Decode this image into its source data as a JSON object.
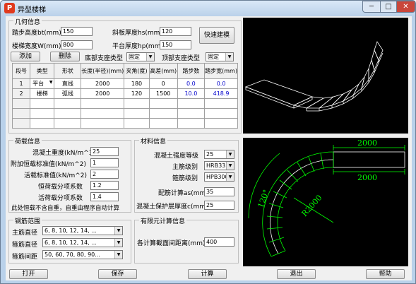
{
  "window": {
    "title": "异型楼梯",
    "app_icon": "P",
    "min_glyph": "─",
    "max_glyph": "□",
    "close_glyph": "✕"
  },
  "geometry": {
    "title": "几何信息",
    "step_height_label": "踏步高度bt(mm)",
    "step_height": "150",
    "slab_thickness_label": "斜板厚度hs(mm)",
    "slab_thickness": "120",
    "stair_width_label": "楼梯宽度W(mm)",
    "stair_width": "800",
    "platform_thickness_label": "平台厚度hp(mm)",
    "platform_thickness": "150",
    "quick_build_label": "快速建模",
    "add_label": "添加",
    "delete_label": "删除",
    "bottom_support_label": "底部支座类型",
    "bottom_support_value": "固定",
    "top_support_label": "顶部支座类型",
    "top_support_value": "固定",
    "table": {
      "headers": [
        "段号",
        "类型",
        "形状",
        "长度(半径)(mm)",
        "夹角(度)",
        "高差(mm)",
        "踏步数",
        "踏步宽(mm)"
      ],
      "rows": [
        [
          "1",
          "平台",
          "直线",
          "2000",
          "180",
          "0",
          "0.0",
          "0.0"
        ],
        [
          "2",
          "楼梯",
          "弧线",
          "2000",
          "120",
          "1500",
          "10.0",
          "418.9"
        ]
      ]
    }
  },
  "load": {
    "title": "荷载信息",
    "concrete_density_label": "混凝土重度(kN/m^3)",
    "concrete_density": "25",
    "dead_load_label": "附加恒载标准值(kN/m^2)",
    "dead_load": "1",
    "live_load_label": "活载标准值(kN/m^2)",
    "live_load": "2",
    "dead_factor_label": "恒荷载分项系数",
    "dead_factor": "1.2",
    "live_factor_label": "活荷载分项系数",
    "live_factor": "1.4",
    "note": "此处恒载不含自重，自重由程序自动计算"
  },
  "material": {
    "title": "材料信息",
    "concrete_grade_label": "混凝土强度等级",
    "concrete_grade": "25",
    "main_bar_label": "主筋级别",
    "main_bar": "HRB335",
    "stirrup_label": "箍筋级别",
    "stirrup": "HPB300",
    "rebar_calc_label": "配筋计算as(mm)",
    "rebar_calc": "35",
    "cover_label": "混凝土保护层厚度c(mm)",
    "cover": "25"
  },
  "rebar_range": {
    "title": "钢筋范围",
    "main_diameter_label": "主筋直径",
    "main_diameter": "6, 8, 10, 12, 14, ...",
    "stirrup_diameter_label": "箍筋直径",
    "stirrup_diameter": "6, 8, 10, 12, 14, ...",
    "stirrup_spacing_label": "箍筋间距",
    "stirrup_spacing": "50, 60, 70, 80, 90..."
  },
  "fem": {
    "title": "有限元计算信息",
    "section_spacing_label": "各计算截面间距离(mm)",
    "section_spacing": "400"
  },
  "plan_view": {
    "top_dimension": "2000",
    "bottom_dimension": "2000",
    "angle_label": "120°",
    "radius_label": "R2000"
  },
  "buttons": {
    "open": "打开",
    "save": "保存",
    "calculate": "计算",
    "exit": "退出",
    "help": "帮助"
  },
  "colors": {
    "accent": "#0000cc",
    "drawing_bg": "#000000",
    "drawing_green": "#00ff00",
    "drawing_white": "#ffffff"
  }
}
